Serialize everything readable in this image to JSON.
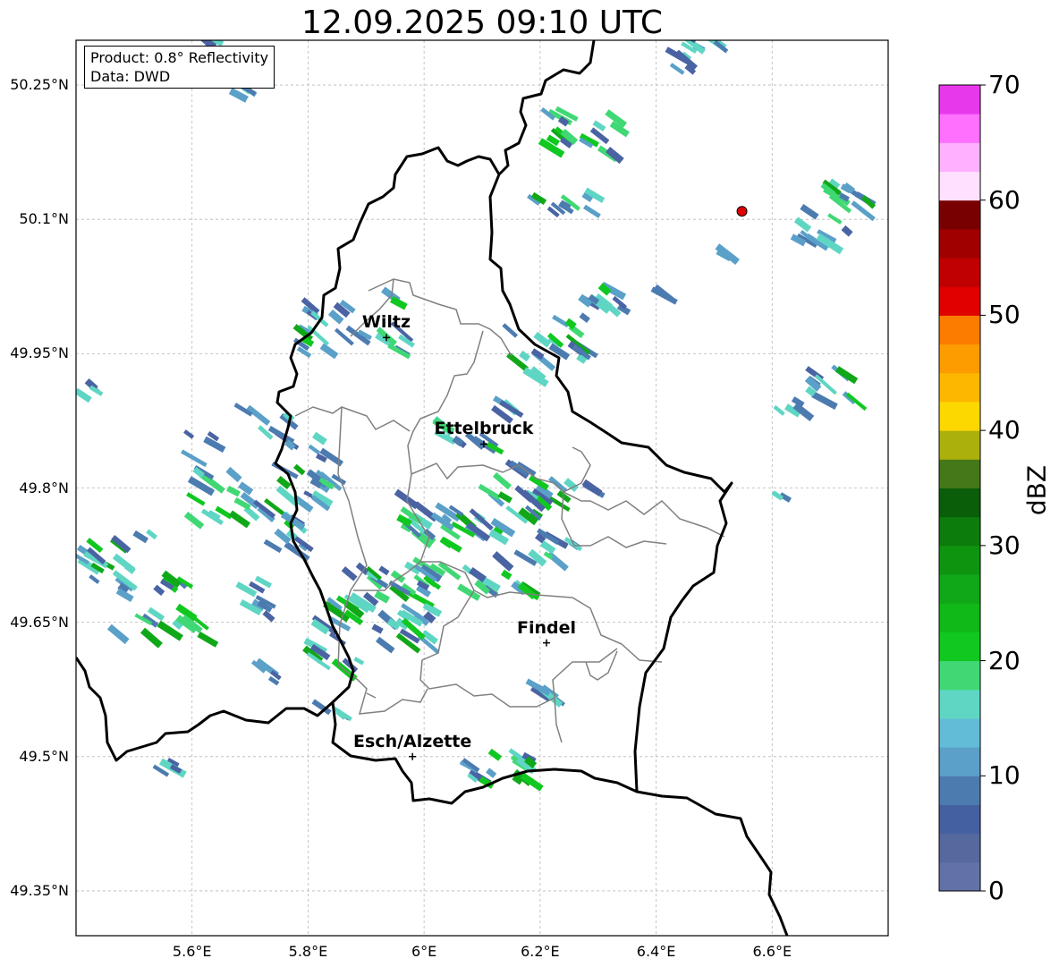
{
  "title": "12.09.2025 09:10 UTC",
  "info": {
    "product_line": "Product: 0.8° Reflectivity",
    "source_line": "Data: DWD"
  },
  "map": {
    "lat_labels": [
      "50.25°N",
      "50.1°N",
      "49.95°N",
      "49.8°N",
      "49.65°N",
      "49.5°N",
      "49.35°N"
    ],
    "lon_labels": [
      "5.6°E",
      "5.8°E",
      "6°E",
      "6.2°E",
      "6.4°E",
      "6.6°E"
    ],
    "lat_ticks": [
      50.25,
      50.1,
      49.95,
      49.8,
      49.65,
      49.5,
      49.35
    ],
    "lon_ticks": [
      5.6,
      5.8,
      6.0,
      6.2,
      6.4,
      6.6
    ],
    "lon_range": [
      5.4,
      6.8
    ],
    "lat_range": [
      49.3,
      50.3
    ],
    "gridlines": true,
    "cities": [
      {
        "name": "Wiltz",
        "lon": 5.935,
        "lat": 49.968
      },
      {
        "name": "Ettelbruck",
        "lon": 6.103,
        "lat": 49.849
      },
      {
        "name": "Findel",
        "lon": 6.211,
        "lat": 49.627
      },
      {
        "name": "Esch/Alzette",
        "lon": 5.98,
        "lat": 49.5
      }
    ],
    "radar_site": {
      "lon": 6.548,
      "lat": 50.109,
      "color": "#e00000"
    }
  },
  "colorbar": {
    "label": "dBZ",
    "tick_labels": [
      "0",
      "10",
      "20",
      "30",
      "40",
      "50",
      "60",
      "70"
    ],
    "min": 0,
    "max": 70,
    "colors": [
      "#6272a8",
      "#55699f",
      "#4560a0",
      "#4c7bb0",
      "#5aa0c8",
      "#62bcd8",
      "#5fd6c4",
      "#40d874",
      "#10c820",
      "#10b818",
      "#10a818",
      "#0f9410",
      "#0c7c0c",
      "#0a5e0a",
      "#447818",
      "#acb00c",
      "#fcd800",
      "#fcb800",
      "#fc9c00",
      "#fc7c00",
      "#e00000",
      "#c00000",
      "#a00000",
      "#780000",
      "#ffe0ff",
      "#ffb0ff",
      "#ff70ff",
      "#e838ec"
    ]
  }
}
